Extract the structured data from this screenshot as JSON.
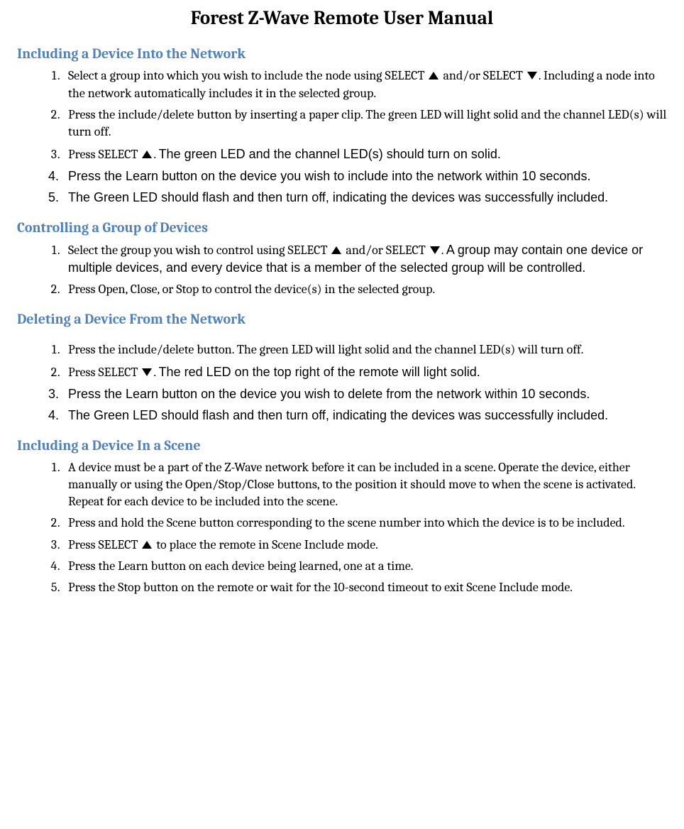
{
  "title": "Forest Z-Wave Remote User Manual",
  "labels": {
    "select": "SELECT"
  },
  "sections": {
    "include": {
      "heading": "Including a Device Into the Network",
      "s1a": "Select a group into which you wish to include the node using ",
      "s1b": " and/or ",
      "s1c": ".  Including a node into the network automatically includes it in the selected group.",
      "s2": "Press the include/delete button by inserting a paper clip.  The green LED will light solid and the channel LED(s) will turn off.",
      "s3a": "Press ",
      "s3b": ".  ",
      "s3c": "The green LED and the channel LED(s) should turn on solid.",
      "s4": "Press the Learn button on the device you wish to include into the network within 10 seconds.",
      "s5": "The Green LED should flash and then turn off, indicating the devices was successfully included."
    },
    "control": {
      "heading": "Controlling a Group of Devices",
      "s1a": "Select the group you wish to control using ",
      "s1b": " and/or ",
      "s1c": ".  ",
      "s1d": "A group may contain one device or multiple devices, and every device that is a member of the selected group will be controlled.",
      "s2": "Press Open, Close, or Stop to control the device(s) in the selected group."
    },
    "delete": {
      "heading": "Deleting a Device From the Network",
      "s1": "Press the include/delete button.  The green LED will light solid and the channel LED(s) will turn off.",
      "s2a": "Press ",
      "s2b": ".  ",
      "s2c": "The red LED on the top right of the remote will light solid.",
      "s3": "Press the Learn button on the device you wish to delete from the network within 10 seconds.",
      "s4": "The Green LED should flash and then turn off, indicating the devices was successfully included."
    },
    "scene": {
      "heading": "Including a Device In a Scene",
      "s1": "A device must be a part of the Z-Wave network before it can be included in a scene.  Operate the device, either manually or using the Open/Stop/Close buttons, to the position it should move to when the scene is activated.  Repeat for each device to be included into the scene.",
      "s2": "Press and hold the Scene button corresponding to the scene number into which the device is to be included.",
      "s3a": "Press SELECT ",
      "s3b": " to place the remote in Scene Include mode.",
      "s4": "Press the Learn button on each device being learned, one at a time.",
      "s5": "Press the Stop button on the remote or wait for the 10-second timeout to exit Scene Include mode."
    }
  }
}
